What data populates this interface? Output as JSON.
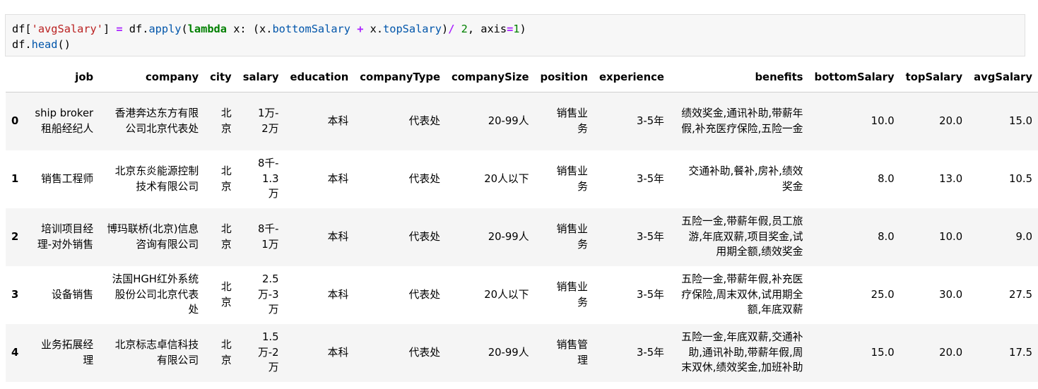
{
  "code": {
    "line1": {
      "p1": "df[",
      "p2": "'avgSalary'",
      "p3": "] ",
      "p4": "=",
      "p5": " df.",
      "p6": "apply",
      "p7": "(",
      "p8": "lambda",
      "p9": " x: (x.",
      "p10": "bottomSalary",
      "p11": " ",
      "p12": "+",
      "p13": " x.",
      "p14": "topSalary",
      "p15": ")",
      "p16": "/",
      "p17": " ",
      "p18": "2",
      "p19": ", axis",
      "p20": "=",
      "p21": "1",
      "p22": ")"
    },
    "line2": {
      "p1": "df.",
      "p2": "head",
      "p3": "()"
    }
  },
  "table": {
    "columns": [
      "job",
      "company",
      "city",
      "salary",
      "education",
      "companyType",
      "companySize",
      "position",
      "experience",
      "benefits",
      "bottomSalary",
      "topSalary",
      "avgSalary"
    ],
    "rows": [
      {
        "index": "0",
        "job": "ship broker 租船经纪人",
        "company": "香港奔达东方有限公司北京代表处",
        "city": "北京",
        "salary": "1万-2万",
        "education": "本科",
        "companyType": "代表处",
        "companySize": "20-99人",
        "position": "销售业务",
        "experience": "3-5年",
        "benefits": "绩效奖金,通讯补助,带薪年假,补充医疗保险,五险一金",
        "bottomSalary": "10.0",
        "topSalary": "20.0",
        "avgSalary": "15.0"
      },
      {
        "index": "1",
        "job": "销售工程师",
        "company": "北京东炎能源控制技术有限公司",
        "city": "北京",
        "salary": "8千-1.3万",
        "education": "本科",
        "companyType": "代表处",
        "companySize": "20人以下",
        "position": "销售业务",
        "experience": "3-5年",
        "benefits": "交通补助,餐补,房补,绩效奖金",
        "bottomSalary": "8.0",
        "topSalary": "13.0",
        "avgSalary": "10.5"
      },
      {
        "index": "2",
        "job": "培训项目经理-对外销售",
        "company": "博玛联桥(北京)信息咨询有限公司",
        "city": "北京",
        "salary": "8千-1万",
        "education": "本科",
        "companyType": "代表处",
        "companySize": "20-99人",
        "position": "销售业务",
        "experience": "3-5年",
        "benefits": "五险一金,带薪年假,员工旅游,年底双薪,项目奖金,试用期全额,绩效奖金",
        "bottomSalary": "8.0",
        "topSalary": "10.0",
        "avgSalary": "9.0"
      },
      {
        "index": "3",
        "job": "设备销售",
        "company": "法国HGH红外系统股份公司北京代表处",
        "city": "北京",
        "salary": "2.5万-3万",
        "education": "本科",
        "companyType": "代表处",
        "companySize": "20人以下",
        "position": "销售业务",
        "experience": "3-5年",
        "benefits": "五险一金,带薪年假,补充医疗保险,周末双休,试用期全额,年底双薪",
        "bottomSalary": "25.0",
        "topSalary": "30.0",
        "avgSalary": "27.5"
      },
      {
        "index": "4",
        "job": "业务拓展经理",
        "company": "北京标志卓信科技有限公司",
        "city": "北京",
        "salary": "1.5万-2万",
        "education": "本科",
        "companyType": "代表处",
        "companySize": "20-99人",
        "position": "销售管理",
        "experience": "3-5年",
        "benefits": "五险一金,年底双薪,交通补助,通讯补助,带薪年假,周末双休,绩效奖金,加班补助",
        "bottomSalary": "15.0",
        "topSalary": "20.0",
        "avgSalary": "17.5"
      }
    ]
  }
}
